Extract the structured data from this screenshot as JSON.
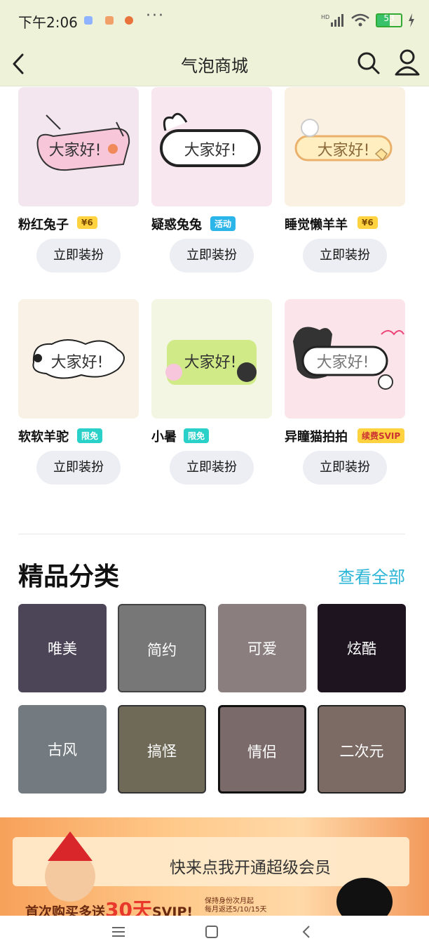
{
  "status": {
    "time": "下午2:06",
    "dots": "···",
    "battery": "53",
    "battery_level": 0.53,
    "net": "HD"
  },
  "header": {
    "title": "气泡商城"
  },
  "bubble_text": "大家好!",
  "products": [
    {
      "name": "粉红兔子",
      "badge": "¥6",
      "badge_type": "price",
      "button": "立即装扮"
    },
    {
      "name": "疑惑兔兔",
      "badge": "活动",
      "badge_type": "event",
      "button": "立即装扮"
    },
    {
      "name": "睡觉懒羊羊",
      "badge": "¥6",
      "badge_type": "price",
      "button": "立即装扮"
    },
    {
      "name": "软软羊驼",
      "badge": "限免",
      "badge_type": "free",
      "button": "立即装扮"
    },
    {
      "name": "小暑",
      "badge": "限免",
      "badge_type": "free",
      "button": "立即装扮"
    },
    {
      "name": "异瞳猫拍拍",
      "badge": "续费SVIP",
      "badge_type": "svip",
      "button": "立即装扮"
    }
  ],
  "section": {
    "title": "精品分类",
    "more": "查看全部"
  },
  "categories": [
    {
      "label": "唯美"
    },
    {
      "label": "简约"
    },
    {
      "label": "可爱"
    },
    {
      "label": "炫酷"
    },
    {
      "label": "古风"
    },
    {
      "label": "搞怪"
    },
    {
      "label": "情侣"
    },
    {
      "label": "二次元"
    }
  ],
  "banner": {
    "cta": "快来点我开通超级会员",
    "promo_prefix": "首次购买多送",
    "promo_highlight": "30天",
    "promo_suffix": "SVIP!",
    "note_line1": "保持身份次月起",
    "note_line2": "每月返还5/10/15天"
  },
  "colors": {
    "accent": "#2bb5d6",
    "header_bg": "#eef2d9",
    "price_badge": "#ffd23f",
    "free_badge": "#2ad1c9",
    "svip_badge": "#ffd23f"
  }
}
